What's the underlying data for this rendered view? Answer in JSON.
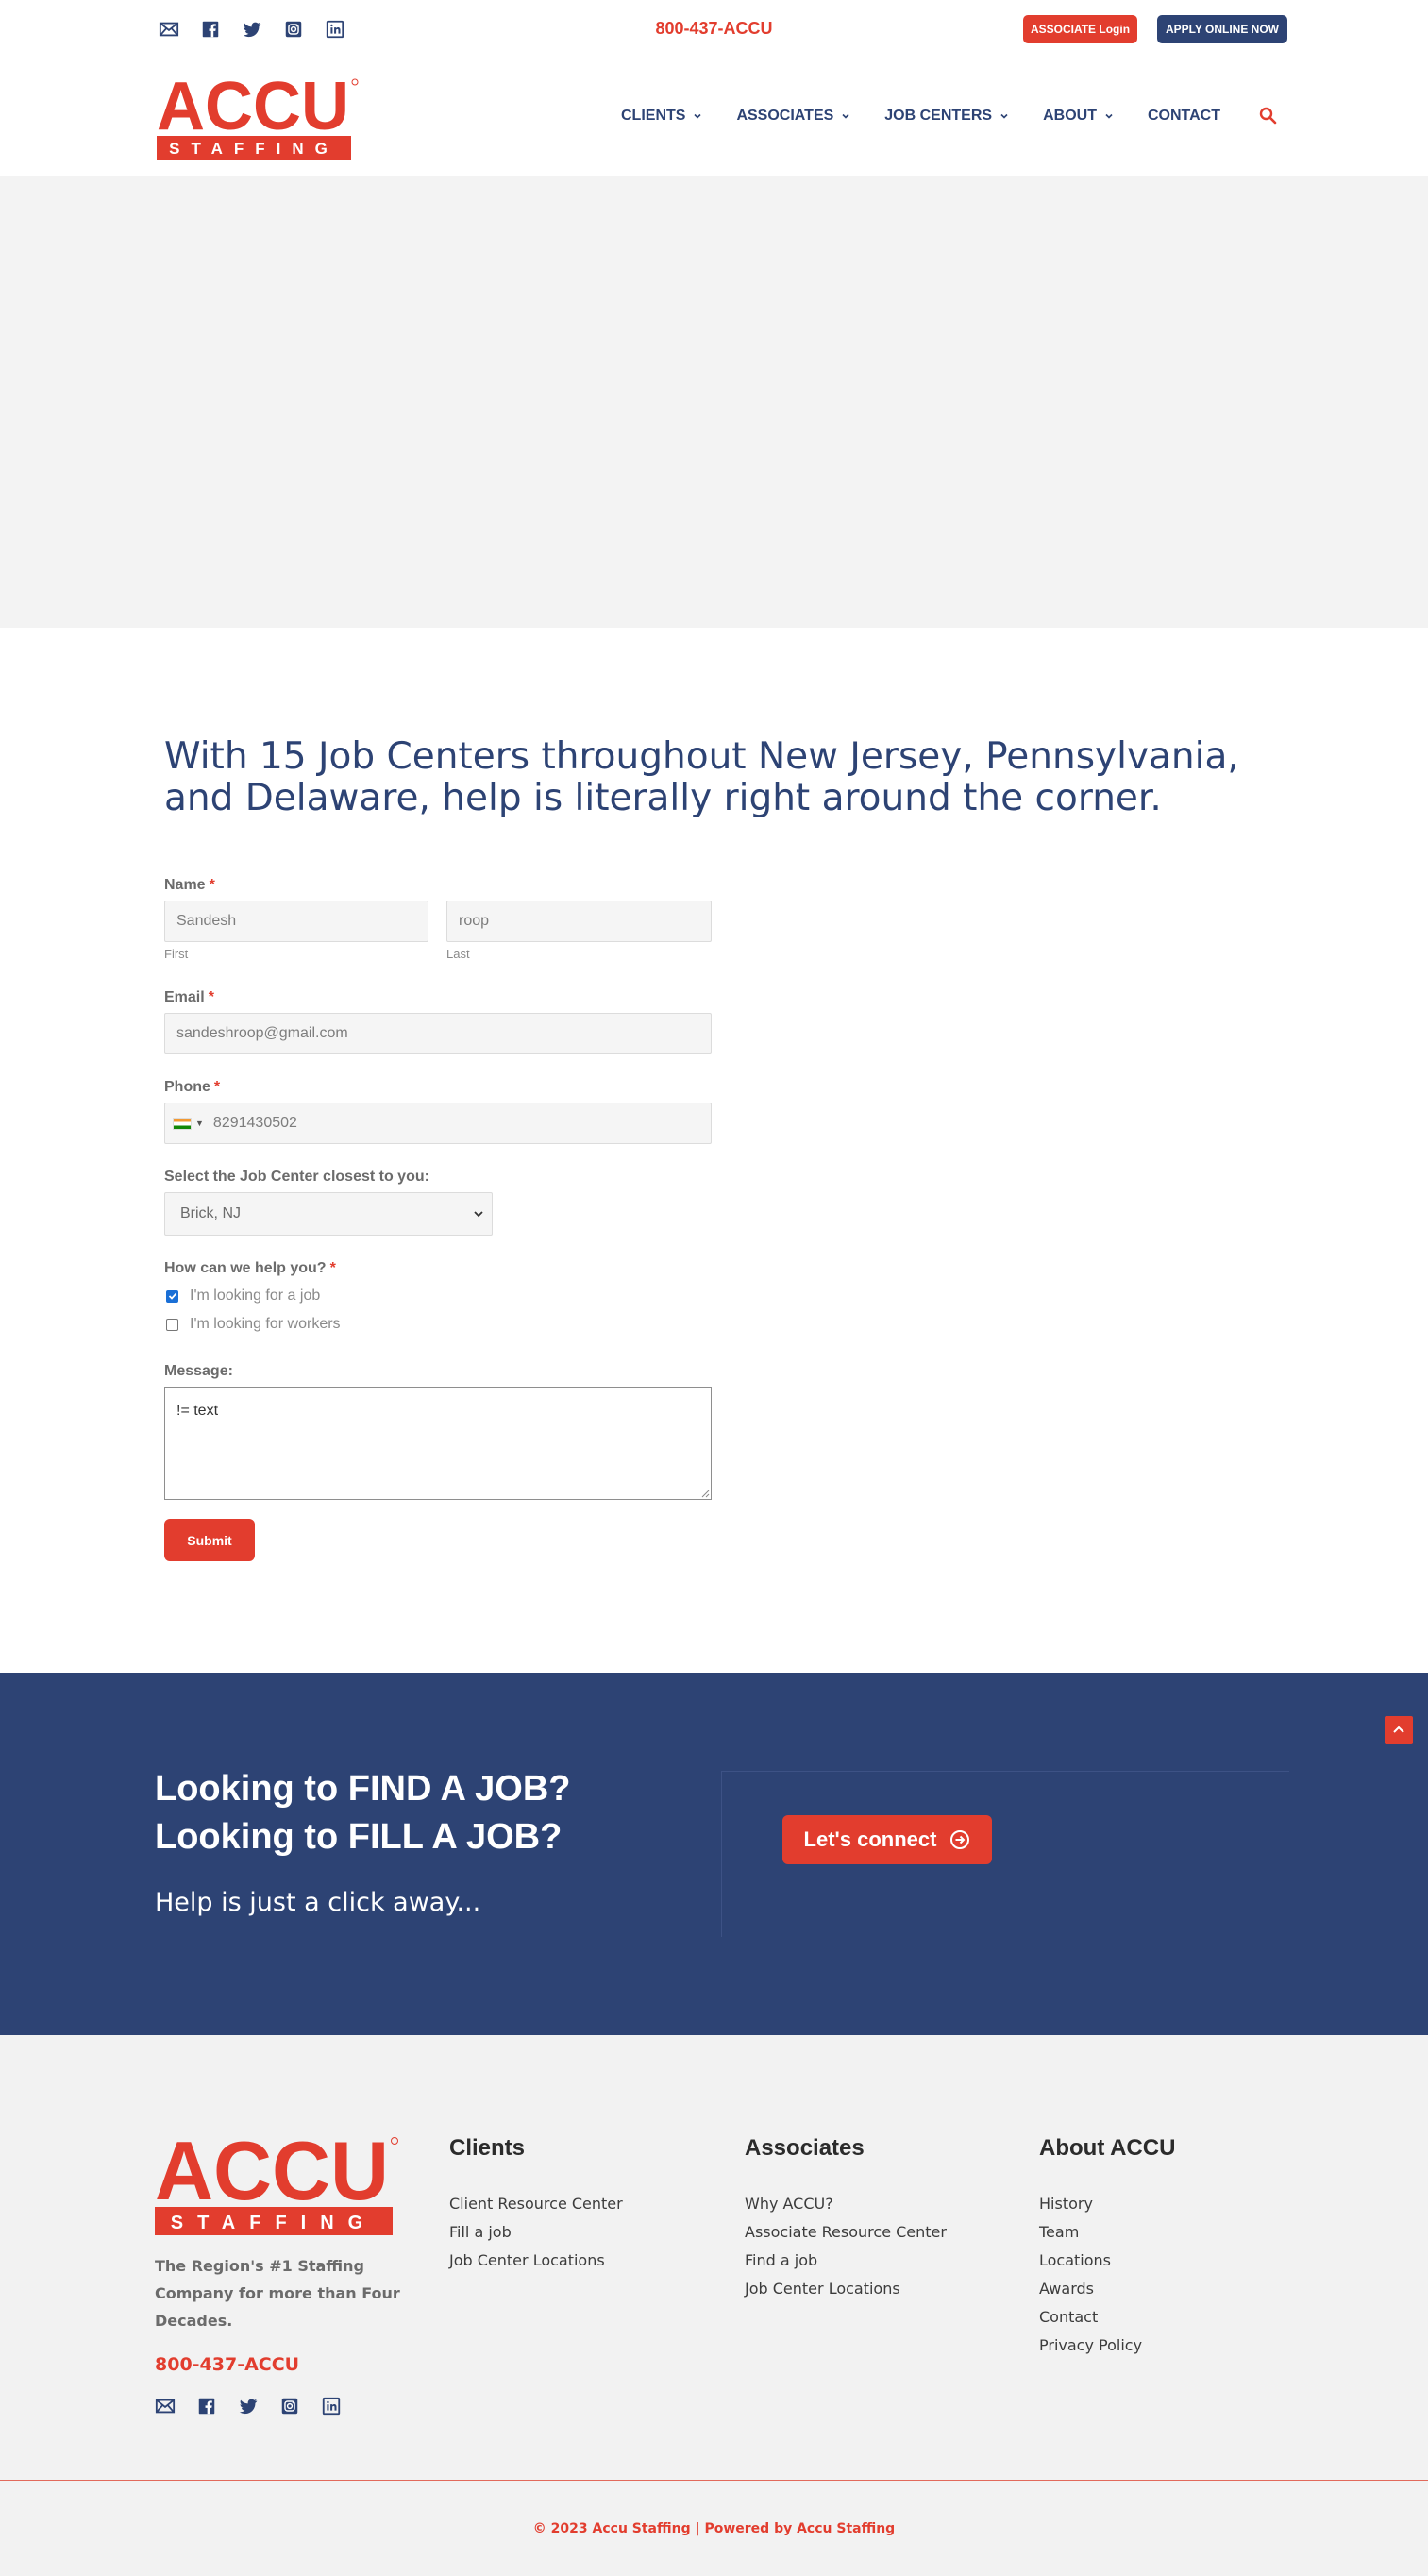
{
  "topbar": {
    "social_icons": [
      "mail-icon",
      "facebook-icon",
      "twitter-icon",
      "instagram-icon",
      "linkedin-icon"
    ],
    "phone": "800-437-ACCU",
    "associate_login": "ASSOCIATE Login",
    "apply_online": "APPLY ONLINE NOW"
  },
  "header": {
    "logo_text": "ACCU",
    "logo_subtext": "STAFFING",
    "nav": [
      {
        "label": "CLIENTS",
        "has_dropdown": true
      },
      {
        "label": "ASSOCIATES",
        "has_dropdown": true
      },
      {
        "label": "JOB CENTERS",
        "has_dropdown": true
      },
      {
        "label": "ABOUT",
        "has_dropdown": true
      },
      {
        "label": "CONTACT",
        "has_dropdown": false
      }
    ],
    "search_icon": "search-icon"
  },
  "form": {
    "intro": "With 15 Job Centers throughout New Jersey, Pennsylvania, and Delaware, help is literally right around the corner.",
    "name_label": "Name",
    "required_mark": "*",
    "first_value": "Sandesh",
    "first_sub": "First",
    "last_value": "roop",
    "last_sub": "Last",
    "email_label": "Email",
    "email_value": "sandeshroop@gmail.com",
    "phone_label": "Phone",
    "phone_value": "8291430502",
    "job_center_label": "Select the Job Center closest to you:",
    "job_center_value": "Brick, NJ",
    "help_label": "How can we help you?",
    "options": [
      {
        "label": "I'm looking for a job",
        "checked": true
      },
      {
        "label": "I'm looking for workers",
        "checked": false
      }
    ],
    "message_label": "Message:",
    "message_value": "!= text",
    "submit": "Submit"
  },
  "cta": {
    "line1": "Looking to FIND A JOB?",
    "line2": "Looking to FILL A JOB?",
    "sub": "Help is just a click away...",
    "button": "Let's connect"
  },
  "footer": {
    "tagline": "The Region's #1 Staffing Company for more than Four Decades.",
    "phone": "800-437-ACCU",
    "columns": [
      {
        "title": "Clients",
        "links": [
          "Client Resource Center",
          "Fill a job",
          "Job Center Locations"
        ]
      },
      {
        "title": "Associates",
        "links": [
          "Why ACCU?",
          "Associate Resource Center",
          "Find a job",
          "Job Center Locations"
        ]
      },
      {
        "title": "About ACCU",
        "links": [
          "History",
          "Team",
          "Locations",
          "Awards",
          "Contact",
          "Privacy Policy"
        ]
      }
    ],
    "copyright": "© 2023 Accu Staffing | Powered by Accu Staffing"
  },
  "colors": {
    "brand_red": "#e23d2e",
    "brand_navy": "#2d4374"
  }
}
